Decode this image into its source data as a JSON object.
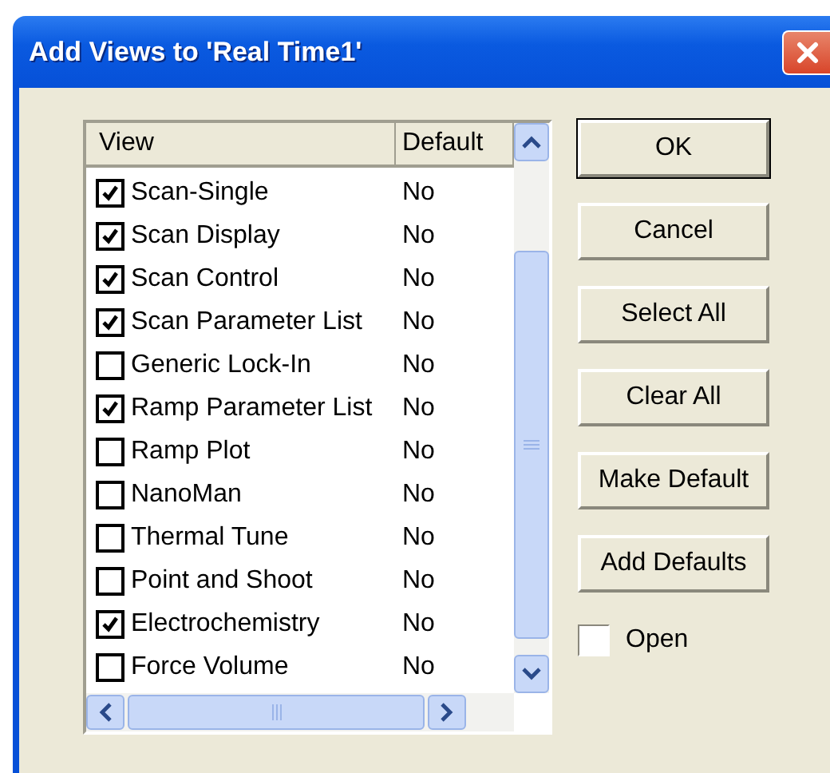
{
  "window": {
    "title": "Add Views to 'Real Time1'"
  },
  "list": {
    "columns": [
      "View",
      "Default"
    ],
    "rows": [
      {
        "name": "Scan-Single",
        "default": "No",
        "checked": true
      },
      {
        "name": "Scan Display",
        "default": "No",
        "checked": true
      },
      {
        "name": "Scan Control",
        "default": "No",
        "checked": true
      },
      {
        "name": "Scan Parameter List",
        "default": "No",
        "checked": true
      },
      {
        "name": "Generic Lock-In",
        "default": "No",
        "checked": false
      },
      {
        "name": "Ramp Parameter List",
        "default": "No",
        "checked": true
      },
      {
        "name": "Ramp Plot",
        "default": "No",
        "checked": false
      },
      {
        "name": "NanoMan",
        "default": "No",
        "checked": false
      },
      {
        "name": "Thermal Tune",
        "default": "No",
        "checked": false
      },
      {
        "name": "Point and Shoot",
        "default": "No",
        "checked": false
      },
      {
        "name": "Electrochemistry",
        "default": "No",
        "checked": true
      },
      {
        "name": "Force Volume",
        "default": "No",
        "checked": false
      }
    ]
  },
  "buttons": [
    {
      "label": "OK",
      "default": true
    },
    {
      "label": "Cancel",
      "default": false
    },
    {
      "label": "Select All",
      "default": false
    },
    {
      "label": "Clear All",
      "default": false
    },
    {
      "label": "Make Default",
      "default": false
    },
    {
      "label": "Add Defaults",
      "default": false
    }
  ],
  "open": {
    "label": "Open",
    "checked": false
  }
}
